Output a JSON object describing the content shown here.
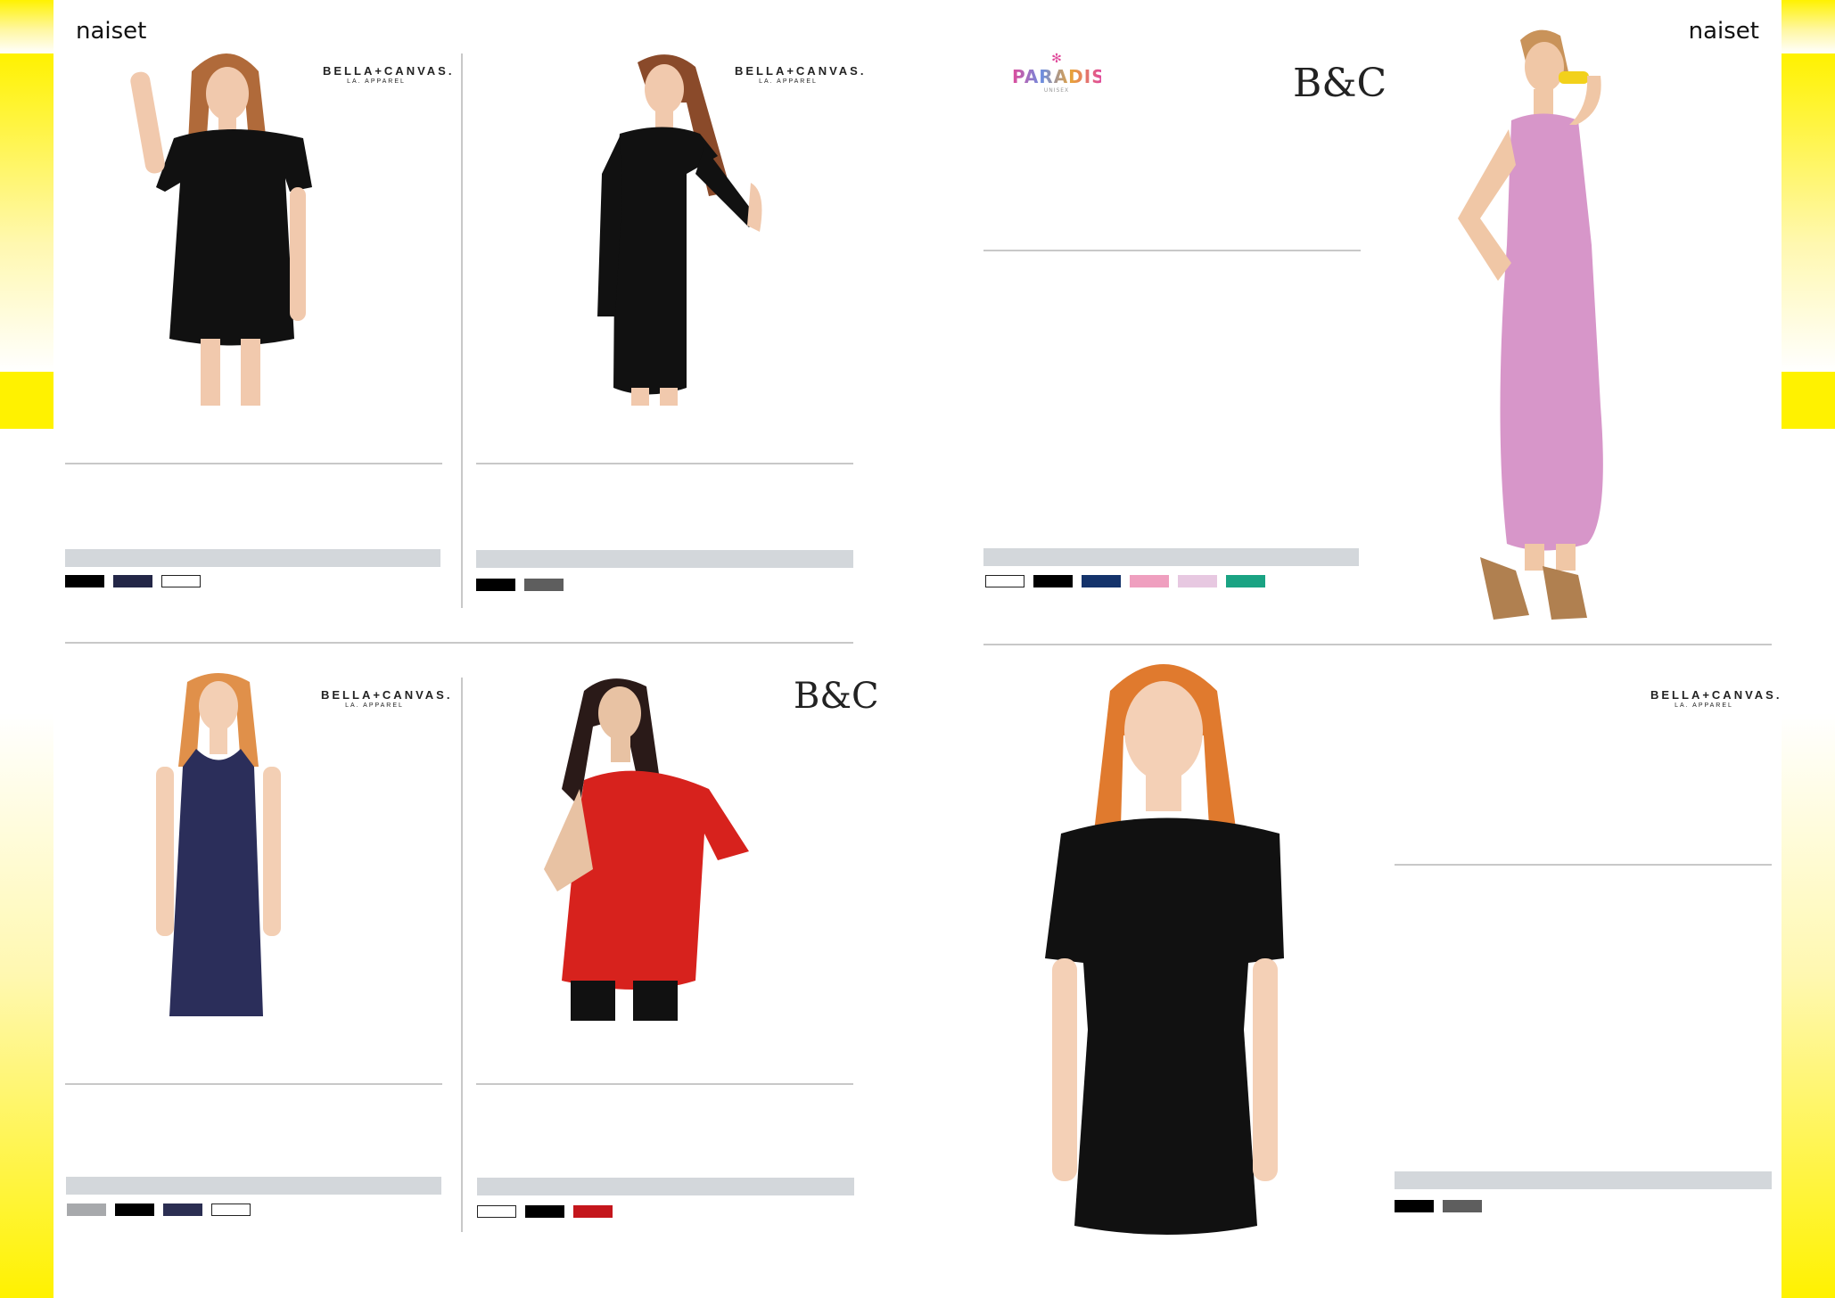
{
  "page": {
    "label_left": "naiset",
    "label_right": "naiset"
  },
  "logos": {
    "bella_canvas_name": "BELLA+CANVAS.",
    "bella_canvas_sub": "LA. APPAREL",
    "bandc": "B&C",
    "paradise_name": "PARADISE",
    "paradise_sub": "UNISEX"
  },
  "products": [
    {
      "id": "p1",
      "brand": "BELLA+CANVAS.",
      "garment": "black short-sleeve t-shirt dress",
      "swatches": [
        "#000000",
        "#232647",
        "#ffffff"
      ]
    },
    {
      "id": "p2",
      "brand": "BELLA+CANVAS.",
      "garment": "black long-sleeve dress",
      "swatches": [
        "#000000",
        "#5e5e5e"
      ]
    },
    {
      "id": "p3",
      "brand": "B&C / PARADISE",
      "garment": "pink maxi tank dress",
      "swatches": [
        "#ffffff",
        "#000000",
        "#14336b",
        "#ef9fbf",
        "#e7c8e1",
        "#1aa383"
      ]
    },
    {
      "id": "p4",
      "brand": "BELLA+CANVAS.",
      "garment": "navy tank dress",
      "swatches": [
        "#a7a9ac",
        "#000000",
        "#2b2e52",
        "#ffffff"
      ]
    },
    {
      "id": "p5",
      "brand": "B&C",
      "garment": "red off-shoulder long tee",
      "swatches": [
        "#ffffff",
        "#000000",
        "#c4161c"
      ]
    },
    {
      "id": "p6",
      "brand": "BELLA+CANVAS.",
      "garment": "black v-neck dress",
      "swatches": [
        "#000000",
        "#5e5e5e"
      ]
    }
  ]
}
